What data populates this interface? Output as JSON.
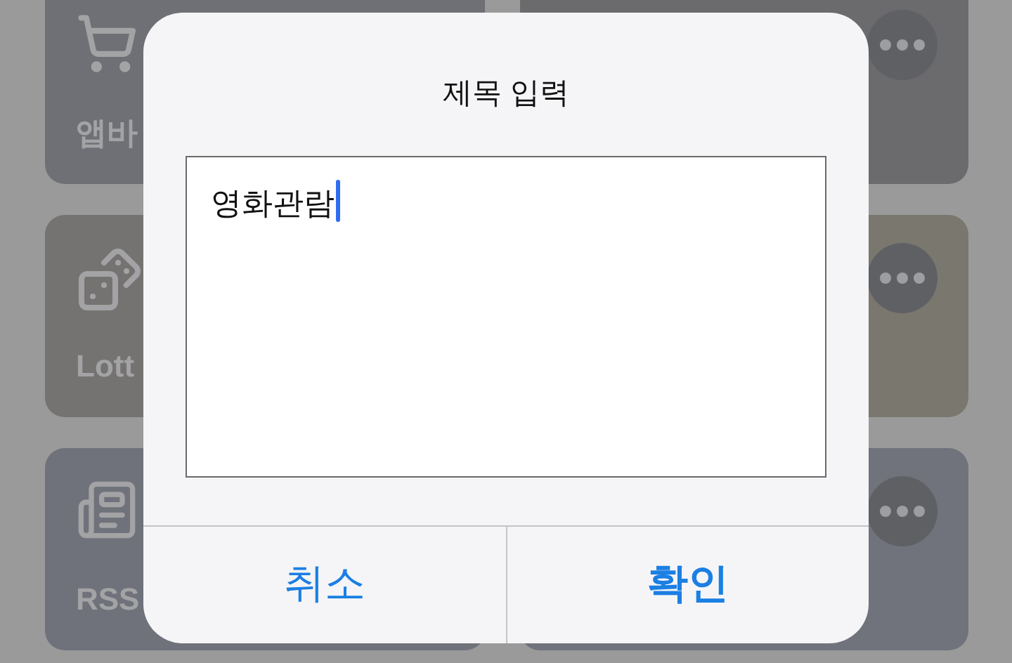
{
  "tiles": [
    {
      "label": "앱바",
      "kind": "cart",
      "color": "#6e7075"
    },
    {
      "kind": "more",
      "color": "#6b6b6d"
    },
    {
      "label": "Lott",
      "kind": "dice",
      "color": "#747371"
    },
    {
      "kind": "more",
      "color": "#7a776f"
    },
    {
      "label": "RSS",
      "kind": "news",
      "color": "#6f727a"
    },
    {
      "kind": "more",
      "color": "#70737b"
    }
  ],
  "dialog": {
    "title": "제목 입력",
    "field": {
      "value": "영화관람",
      "focused": true
    },
    "buttons": [
      {
        "label": "취소",
        "primary": false
      },
      {
        "label": "확인",
        "primary": true
      }
    ]
  }
}
